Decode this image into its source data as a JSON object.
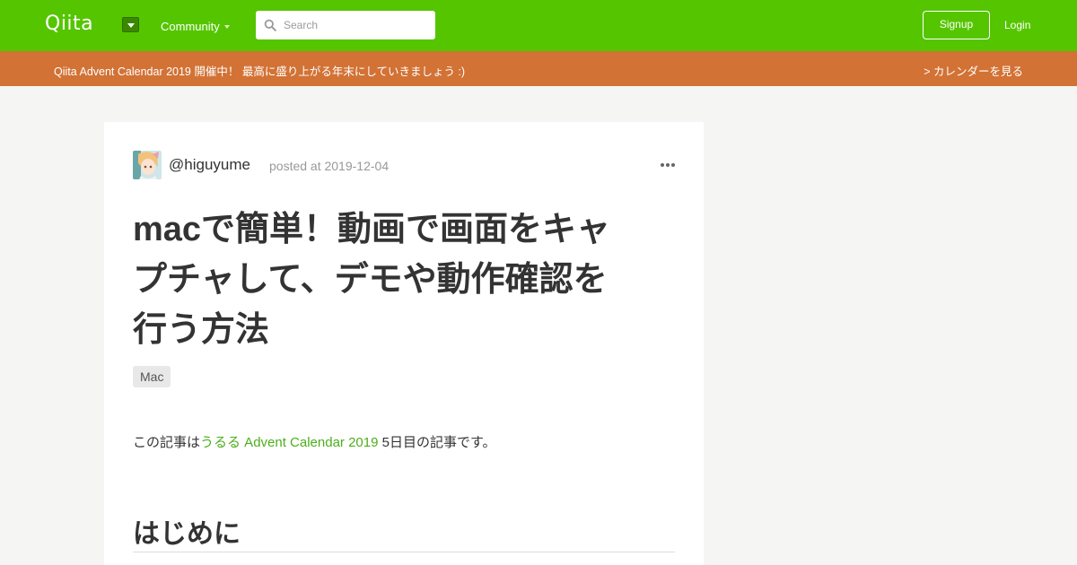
{
  "header": {
    "logo": "Qiita",
    "community_label": "Community",
    "search_placeholder": "Search",
    "signup_label": "Signup",
    "login_label": "Login",
    "brand_color": "#55c500"
  },
  "announcement": {
    "text": "Qiita Advent Calendar 2019 開催中！ 最高に盛り上がる年末にしていきましょう :)",
    "link_label": "> カレンダーを見る",
    "color": "#d27235"
  },
  "article": {
    "author": "@higuyume",
    "posted": "posted at 2019-12-04",
    "title_lines": [
      "macで簡単！動画で画面をキャ",
      "プチャして、デモや動作確認を",
      "行う方法"
    ],
    "tag": "Mac",
    "intro_prefix": "この記事は",
    "intro_link": "うるる Advent Calendar 2019",
    "intro_suffix": " 5日目の記事です。",
    "section_heading": "はじめに"
  }
}
